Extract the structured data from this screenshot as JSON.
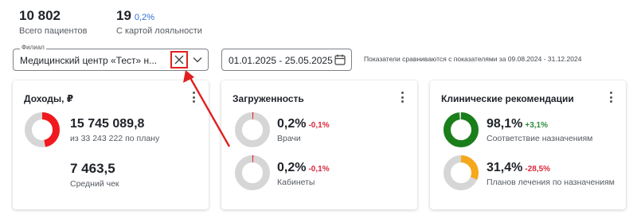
{
  "stats": {
    "patients": {
      "value": "10 802",
      "label": "Всего пациентов"
    },
    "loyalty": {
      "value": "19",
      "delta": "0,2%",
      "label": "С картой лояльности"
    }
  },
  "filters": {
    "branch": {
      "legend": "Филиал",
      "value": "Медицинский центр «Тест» н...",
      "clear_icon": "close-icon",
      "dropdown_icon": "chevron-down-icon"
    },
    "dates": {
      "value": "01.01.2025 - 25.05.2025",
      "icon": "calendar-icon"
    },
    "comparison_note": "Показатели сравниваются с показателями за 09.08.2024 - 31.12.2024"
  },
  "cards": {
    "income": {
      "title": "Доходы, ₽",
      "amount": {
        "value": "15 745 089,8",
        "sub": "из 33 243 222 по плану",
        "fill": 0.47,
        "color": "#f0191e"
      },
      "check": {
        "value": "7 463,5",
        "sub": "Средний чек"
      }
    },
    "load": {
      "title": "Загруженность",
      "doctors": {
        "value": "0,2%",
        "delta": "-0,1%",
        "sub": "Врачи",
        "fill": 0.002,
        "color": "#f0191e"
      },
      "rooms": {
        "value": "0,2%",
        "delta": "-0,1%",
        "sub": "Кабинеты",
        "fill": 0.002,
        "color": "#f0191e"
      }
    },
    "clinical": {
      "title": "Клинические рекомендации",
      "compliance": {
        "value": "98,1%",
        "delta": "+3,1%",
        "sub": "Соответствие назначениям",
        "fill": 0.981,
        "color": "#1a7e1a"
      },
      "plans": {
        "value": "31,4%",
        "delta": "-28,5%",
        "sub": "Планов лечения по назначениям",
        "fill": 0.314,
        "color": "#f5a81c"
      }
    }
  },
  "colors": {
    "track": "#d6d6d6",
    "accent": "#2f6fd6",
    "annotation": "#e02020"
  }
}
